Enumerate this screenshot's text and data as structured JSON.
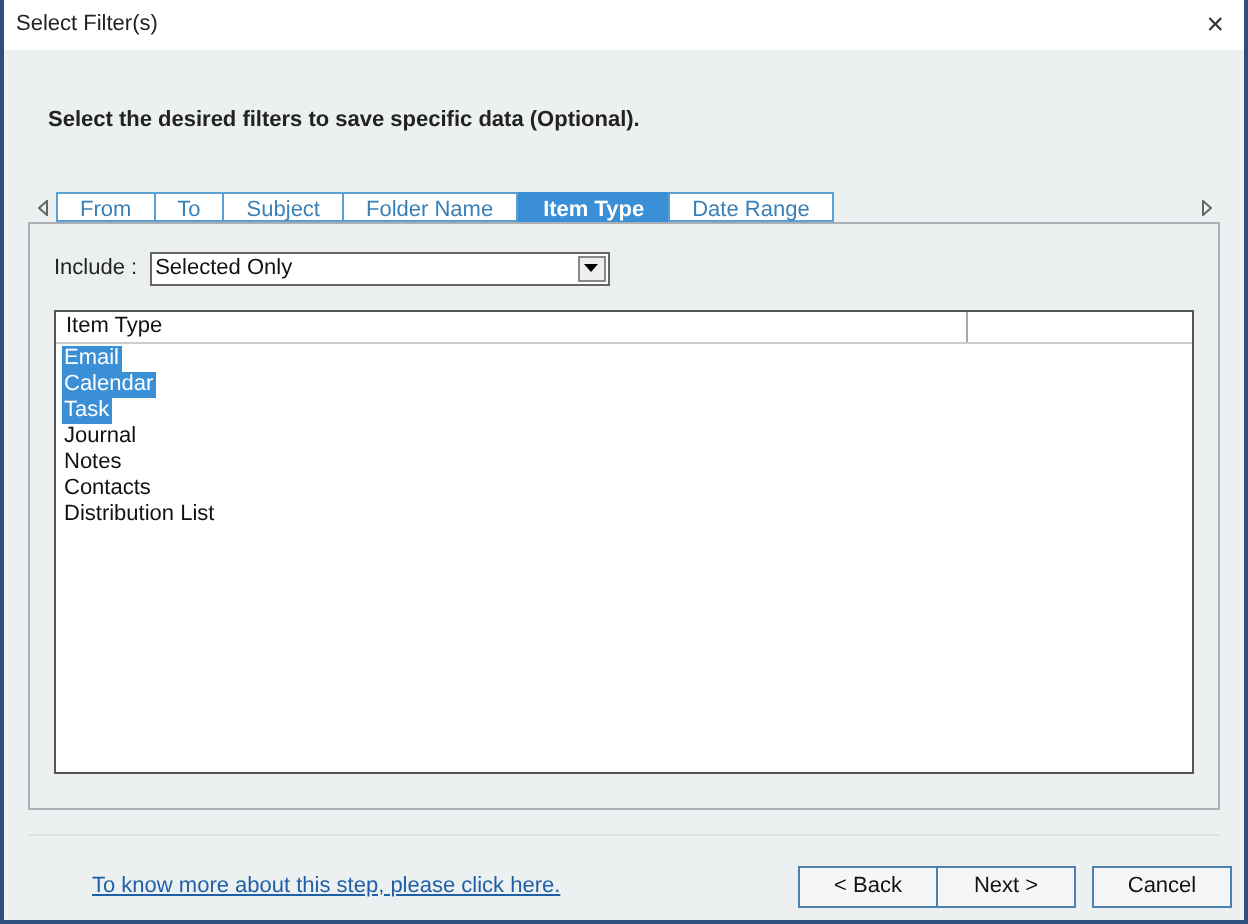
{
  "window": {
    "title": "Select Filter(s)",
    "close": "×"
  },
  "instruction": "Select the desired filters to save specific data (Optional).",
  "tabs": [
    {
      "label": "From",
      "selected": false
    },
    {
      "label": "To",
      "selected": false
    },
    {
      "label": "Subject",
      "selected": false
    },
    {
      "label": "Folder Name",
      "selected": false
    },
    {
      "label": "Item Type",
      "selected": true
    },
    {
      "label": "Date Range",
      "selected": false
    }
  ],
  "include": {
    "label": "Include :",
    "value": "Selected Only"
  },
  "list": {
    "columns": [
      "Item Type"
    ],
    "items": [
      {
        "label": "Email",
        "selected": true
      },
      {
        "label": "Calendar",
        "selected": true
      },
      {
        "label": "Task",
        "selected": true
      },
      {
        "label": "Journal",
        "selected": false
      },
      {
        "label": "Notes",
        "selected": false
      },
      {
        "label": "Contacts",
        "selected": false
      },
      {
        "label": "Distribution List",
        "selected": false
      }
    ]
  },
  "help_link": "To know more about this step, please click here.",
  "buttons": [
    "< Back",
    "Next >",
    "Cancel"
  ]
}
